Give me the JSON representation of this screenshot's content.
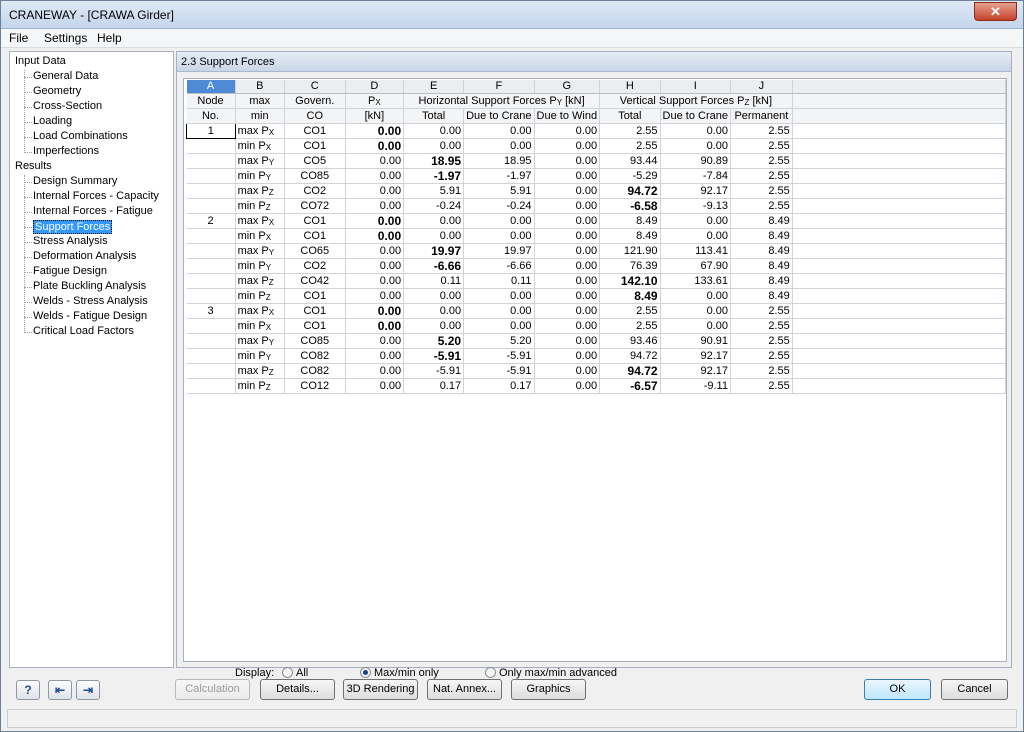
{
  "window": {
    "title": "CRANEWAY - [CRAWA Girder]",
    "close_label": "✕"
  },
  "menu": [
    "File",
    "Settings",
    "Help"
  ],
  "nav": {
    "input_label": "Input Data",
    "input_items": [
      "General Data",
      "Geometry",
      "Cross-Section",
      "Loading",
      "Load Combinations",
      "Imperfections"
    ],
    "results_label": "Results",
    "results_items": [
      "Design Summary",
      "Internal Forces - Capacity",
      "Internal Forces - Fatigue",
      "Support Forces",
      "Stress Analysis",
      "Deformation Analysis",
      "Fatigue Design",
      "Plate Buckling Analysis",
      "Welds - Stress Analysis",
      "Welds - Fatigue Design",
      "Critical Load Factors"
    ],
    "selected": "Support Forces"
  },
  "section_title": "2.3 Support Forces",
  "table": {
    "col_letters": [
      "A",
      "B",
      "C",
      "D",
      "E",
      "F",
      "G",
      "H",
      "I",
      "J"
    ],
    "header": {
      "node1": "Node",
      "node2": "No.",
      "maxmin1": "max",
      "maxmin2": "min",
      "co1": "Govern.",
      "co2": "CO",
      "px1": "P",
      "px1_sub": "X",
      "px2": "[kN]",
      "horiz": "Horizontal",
      "horiz2": "Support Forces P",
      "horiz2_sub": "Y",
      "horiz2_unit": "[kN]",
      "h_total": "Total",
      "h_crane": "Due to Crane",
      "h_wind": "Due to Wind",
      "vert": "Vertical",
      "vert2": "Support Forces P",
      "vert2_sub": "Z",
      "vert2_unit": "[kN]",
      "v_total": "Total",
      "v_crane": "Due to Crane",
      "v_perm": "Permanent"
    },
    "rows": [
      {
        "node": "1",
        "mm": "max P",
        "sub": "X",
        "co": "CO1",
        "px": "0.00",
        "ht": "0.00",
        "hc": "0.00",
        "hw": "0.00",
        "vt": "2.55",
        "vc": "0.00",
        "vp": "2.55",
        "b": [
          "px"
        ]
      },
      {
        "node": "",
        "mm": "min P",
        "sub": "X",
        "co": "CO1",
        "px": "0.00",
        "ht": "0.00",
        "hc": "0.00",
        "hw": "0.00",
        "vt": "2.55",
        "vc": "0.00",
        "vp": "2.55",
        "b": [
          "px"
        ]
      },
      {
        "node": "",
        "mm": "max P",
        "sub": "Y",
        "co": "CO5",
        "px": "0.00",
        "ht": "18.95",
        "hc": "18.95",
        "hw": "0.00",
        "vt": "93.44",
        "vc": "90.89",
        "vp": "2.55",
        "b": [
          "ht"
        ]
      },
      {
        "node": "",
        "mm": "min P",
        "sub": "Y",
        "co": "CO85",
        "px": "0.00",
        "ht": "-1.97",
        "hc": "-1.97",
        "hw": "0.00",
        "vt": "-5.29",
        "vc": "-7.84",
        "vp": "2.55",
        "b": [
          "ht"
        ]
      },
      {
        "node": "",
        "mm": "max P",
        "sub": "Z",
        "co": "CO2",
        "px": "0.00",
        "ht": "5.91",
        "hc": "5.91",
        "hw": "0.00",
        "vt": "94.72",
        "vc": "92.17",
        "vp": "2.55",
        "b": [
          "vt"
        ]
      },
      {
        "node": "",
        "mm": "min P",
        "sub": "Z",
        "co": "CO72",
        "px": "0.00",
        "ht": "-0.24",
        "hc": "-0.24",
        "hw": "0.00",
        "vt": "-6.58",
        "vc": "-9.13",
        "vp": "2.55",
        "b": [
          "vt"
        ]
      },
      {
        "node": "2",
        "mm": "max P",
        "sub": "X",
        "co": "CO1",
        "px": "0.00",
        "ht": "0.00",
        "hc": "0.00",
        "hw": "0.00",
        "vt": "8.49",
        "vc": "0.00",
        "vp": "8.49",
        "b": [
          "px"
        ]
      },
      {
        "node": "",
        "mm": "min P",
        "sub": "X",
        "co": "CO1",
        "px": "0.00",
        "ht": "0.00",
        "hc": "0.00",
        "hw": "0.00",
        "vt": "8.49",
        "vc": "0.00",
        "vp": "8.49",
        "b": [
          "px"
        ]
      },
      {
        "node": "",
        "mm": "max P",
        "sub": "Y",
        "co": "CO65",
        "px": "0.00",
        "ht": "19.97",
        "hc": "19.97",
        "hw": "0.00",
        "vt": "121.90",
        "vc": "113.41",
        "vp": "8.49",
        "b": [
          "ht"
        ]
      },
      {
        "node": "",
        "mm": "min P",
        "sub": "Y",
        "co": "CO2",
        "px": "0.00",
        "ht": "-6.66",
        "hc": "-6.66",
        "hw": "0.00",
        "vt": "76.39",
        "vc": "67.90",
        "vp": "8.49",
        "b": [
          "ht"
        ]
      },
      {
        "node": "",
        "mm": "max P",
        "sub": "Z",
        "co": "CO42",
        "px": "0.00",
        "ht": "0.11",
        "hc": "0.11",
        "hw": "0.00",
        "vt": "142.10",
        "vc": "133.61",
        "vp": "8.49",
        "b": [
          "vt"
        ]
      },
      {
        "node": "",
        "mm": "min P",
        "sub": "Z",
        "co": "CO1",
        "px": "0.00",
        "ht": "0.00",
        "hc": "0.00",
        "hw": "0.00",
        "vt": "8.49",
        "vc": "0.00",
        "vp": "8.49",
        "b": [
          "vt"
        ]
      },
      {
        "node": "3",
        "mm": "max P",
        "sub": "X",
        "co": "CO1",
        "px": "0.00",
        "ht": "0.00",
        "hc": "0.00",
        "hw": "0.00",
        "vt": "2.55",
        "vc": "0.00",
        "vp": "2.55",
        "b": [
          "px"
        ]
      },
      {
        "node": "",
        "mm": "min P",
        "sub": "X",
        "co": "CO1",
        "px": "0.00",
        "ht": "0.00",
        "hc": "0.00",
        "hw": "0.00",
        "vt": "2.55",
        "vc": "0.00",
        "vp": "2.55",
        "b": [
          "px"
        ]
      },
      {
        "node": "",
        "mm": "max P",
        "sub": "Y",
        "co": "CO85",
        "px": "0.00",
        "ht": "5.20",
        "hc": "5.20",
        "hw": "0.00",
        "vt": "93.46",
        "vc": "90.91",
        "vp": "2.55",
        "b": [
          "ht"
        ]
      },
      {
        "node": "",
        "mm": "min P",
        "sub": "Y",
        "co": "CO82",
        "px": "0.00",
        "ht": "-5.91",
        "hc": "-5.91",
        "hw": "0.00",
        "vt": "94.72",
        "vc": "92.17",
        "vp": "2.55",
        "b": [
          "ht"
        ]
      },
      {
        "node": "",
        "mm": "max P",
        "sub": "Z",
        "co": "CO82",
        "px": "0.00",
        "ht": "-5.91",
        "hc": "-5.91",
        "hw": "0.00",
        "vt": "94.72",
        "vc": "92.17",
        "vp": "2.55",
        "b": [
          "vt"
        ]
      },
      {
        "node": "",
        "mm": "min P",
        "sub": "Z",
        "co": "CO12",
        "px": "0.00",
        "ht": "0.17",
        "hc": "0.17",
        "hw": "0.00",
        "vt": "-6.57",
        "vc": "-9.11",
        "vp": "2.55",
        "b": [
          "vt"
        ]
      }
    ]
  },
  "display": {
    "label": "Display:",
    "options": [
      "All",
      "Max/min only",
      "Only max/min advanced"
    ],
    "selected": "Max/min only"
  },
  "buttons": {
    "calculation": "Calculation",
    "details": "Details...",
    "rendering": "3D Rendering",
    "annex": "Nat. Annex...",
    "graphics": "Graphics",
    "ok": "OK",
    "cancel": "Cancel"
  },
  "icons": [
    "help-icon",
    "import-icon",
    "export-icon"
  ]
}
